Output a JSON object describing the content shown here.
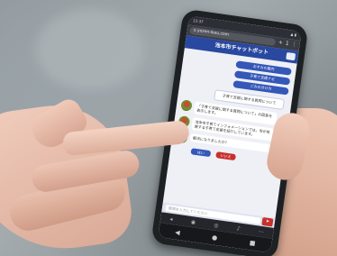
{
  "browser": {
    "url_text": "⌂ yozen-ikeu.com",
    "tab_count": "1",
    "status_time": "12:37",
    "status_icons": "▲ ▮"
  },
  "chat": {
    "header_title": "池本市チャットボット",
    "options": [
      "おすみの案内",
      "子育て支援ナビ",
      "ごみの分け方"
    ],
    "user_message": "子育て支援に関する質問について",
    "bot_messages": [
      "「子育て支援に関する質問について」の回答を表示します。",
      "池本市子育てインフォメーションでは、市が実施する子育て支援を紹介しています。",
      "解決になりましたか？"
    ],
    "yes_label": "はい",
    "no_label": "いいえ",
    "input_placeholder": "質問を入力してください",
    "send_icon": "➤"
  },
  "colors": {
    "header": "#2948a0",
    "option_button": "#3457b8",
    "yes_button": "#3457b8",
    "no_button": "#c9302c"
  }
}
